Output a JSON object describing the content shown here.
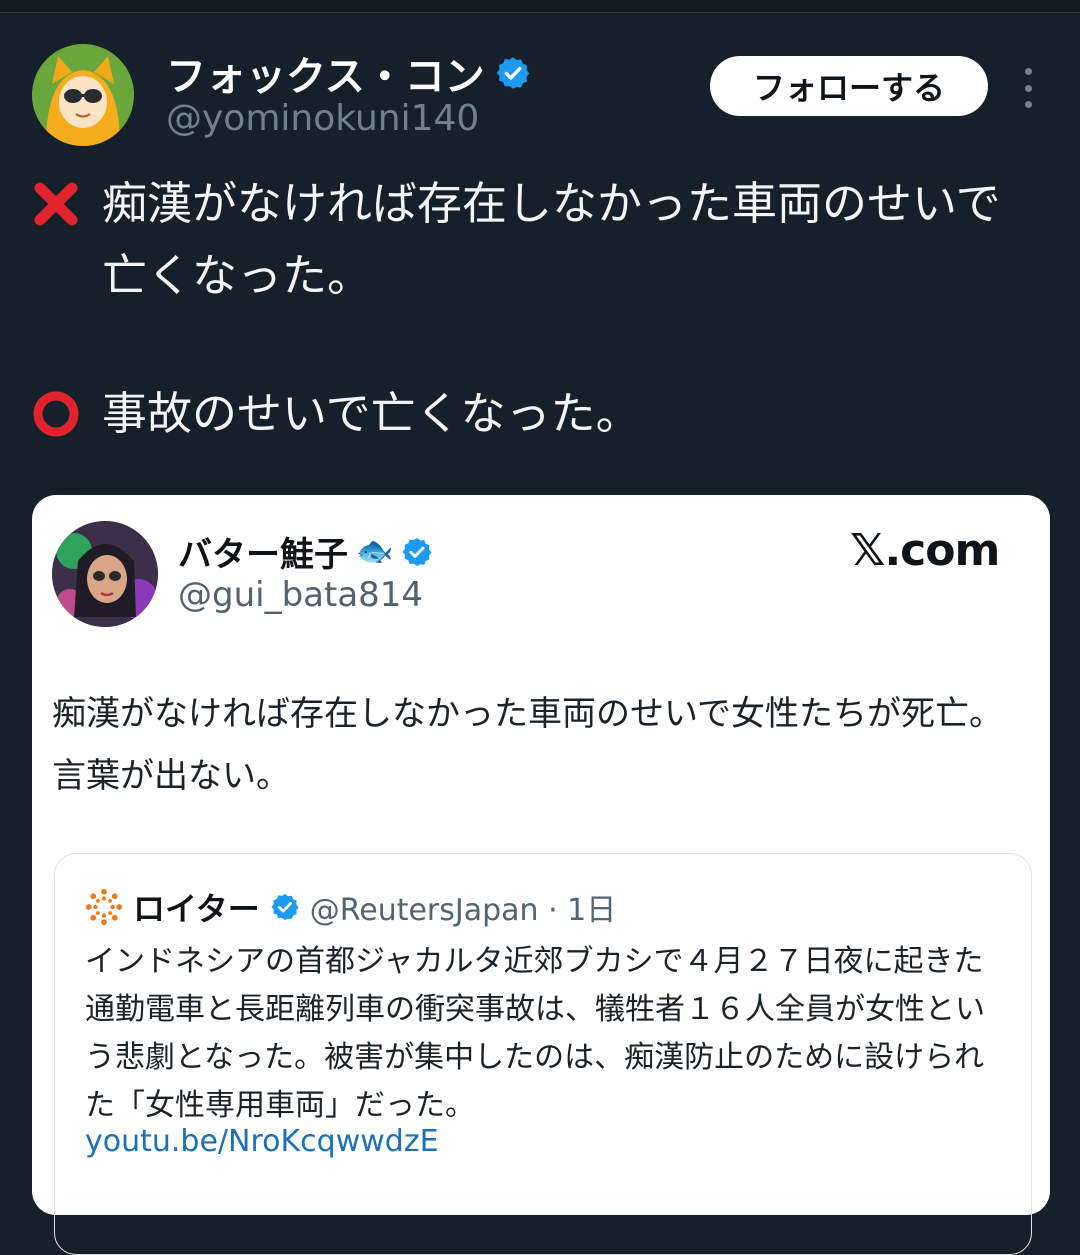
{
  "author": {
    "display_name": "フォックス・コン",
    "handle": "@yominokuni140",
    "verified": true
  },
  "follow_label": "フォローする",
  "post": {
    "line1_text": "痴漢がなければ存在しなかった車両のせいで亡くなった。",
    "line2_text": "事故のせいで亡くなった。",
    "line1_icon": "cross-mark-icon",
    "line2_icon": "circle-mark-icon"
  },
  "quoted": {
    "display_name": "バター鮭子",
    "name_emoji": "🐟",
    "handle": "@gui_bata814",
    "site_label": "𝕏.com",
    "text": "痴漢がなければ存在しなかった車両のせいで女性たちが死亡。言葉が出ない。",
    "nested": {
      "name": "ロイター",
      "handle_time": "@ReutersJapan · 1日",
      "text": "インドネシアの首都ジャカルタ近郊ブカシで４月２７日夜に起きた通勤電車と長距離列車の衝突事故は、犠牲者１６人全員が女性という悲劇となった。被害が集中したのは、痴漢防止のために設けられた「女性専用車両」だった。",
      "link": "youtu.be/NroKcqwwdzE"
    }
  },
  "colors": {
    "background": "#16202b",
    "verified_blue": "#1d9bf0",
    "link_blue": "#1d6fb8",
    "cross_red": "#e0242e",
    "handle_gray": "#71808d"
  }
}
